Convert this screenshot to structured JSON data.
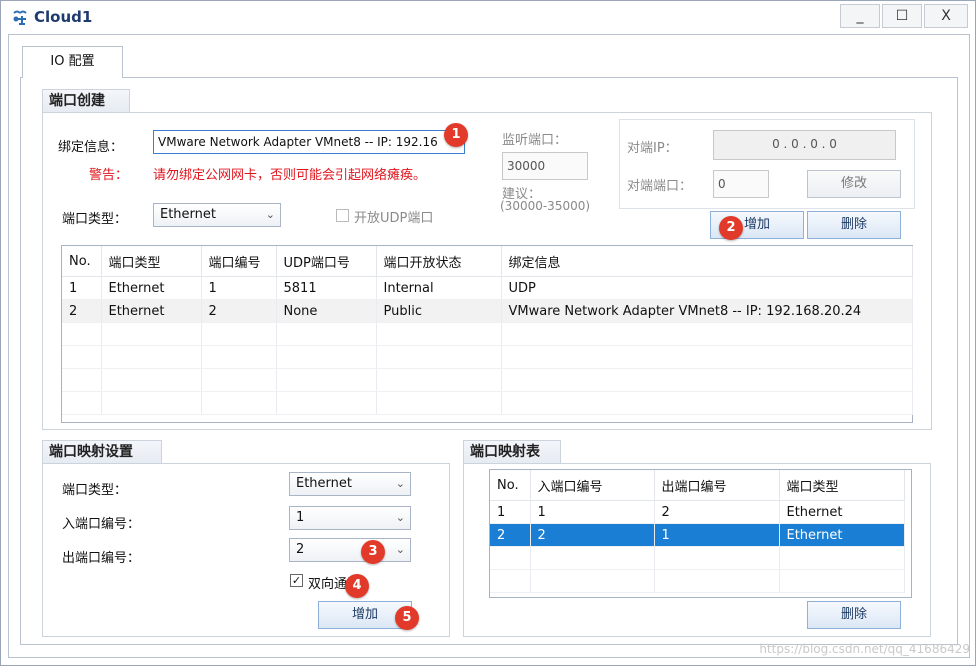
{
  "window": {
    "title": "Cloud1",
    "controls": [
      "_",
      "☐",
      "X"
    ]
  },
  "tab": {
    "label": "IO 配置"
  },
  "port_creation": {
    "header": "端口创建",
    "binding_label": "绑定信息：",
    "binding_value": "VMware Network Adapter VMnet8 -- IP: 192.16",
    "warning_label": "警告：",
    "warning_text": "请勿绑定公网网卡，否则可能会引起网络瘫痪。",
    "port_type_label": "端口类型：",
    "port_type_value": "Ethernet",
    "listen_port_label": "监听端口：",
    "listen_port_value": "30000",
    "suggest_label": "建议：",
    "suggest_range": "(30000-35000)",
    "open_udp_label": "开放UDP端口",
    "peer_ip_label": "对端IP：",
    "peer_ip_value": "0  .  0  .  0  .  0",
    "peer_port_label": "对端端口：",
    "peer_port_value": "0",
    "modify_button": "修改",
    "add_button": "增加",
    "delete_button": "删除"
  },
  "port_table": {
    "columns": [
      "No.",
      "端口类型",
      "端口编号",
      "UDP端口号",
      "端口开放状态",
      "绑定信息"
    ],
    "rows": [
      [
        "1",
        "Ethernet",
        "1",
        "5811",
        "Internal",
        "UDP"
      ],
      [
        "2",
        "Ethernet",
        "2",
        "None",
        "Public",
        "VMware Network Adapter VMnet8 -- IP: 192.168.20.24"
      ]
    ]
  },
  "mapping_settings": {
    "header": "端口映射设置",
    "port_type_label": "端口类型：",
    "port_type_value": "Ethernet",
    "in_port_label": "入端口编号：",
    "in_port_value": "1",
    "out_port_label": "出端口编号：",
    "out_port_value": "2",
    "bidirectional_label": "双向通道",
    "add_button": "增加"
  },
  "mapping_table": {
    "header": "端口映射表",
    "columns": [
      "No.",
      "入端口编号",
      "出端口编号",
      "端口类型"
    ],
    "rows": [
      [
        "1",
        "1",
        "2",
        "Ethernet"
      ],
      [
        "2",
        "2",
        "1",
        "Ethernet"
      ]
    ],
    "delete_button": "删除"
  },
  "badges": [
    "1",
    "2",
    "3",
    "4",
    "5"
  ],
  "watermark": "https://blog.csdn.net/qq_41686429",
  "colors": {
    "badge": "#e23a2a",
    "selection": "#1a7fd4",
    "warning": "#e0161e",
    "title": "#1e3a6e"
  }
}
